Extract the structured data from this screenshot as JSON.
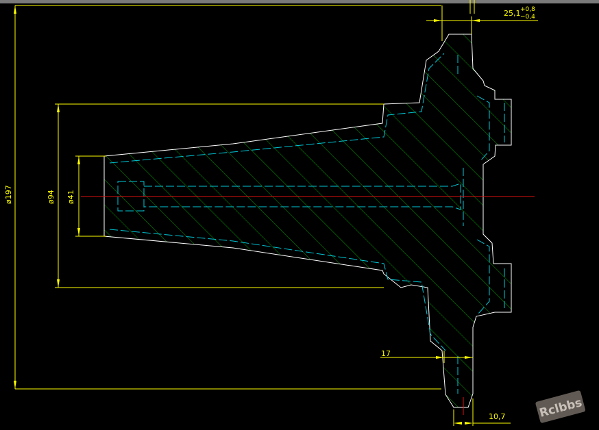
{
  "drawing": {
    "dimensions": {
      "dia_197": "ø197",
      "dia_94": "ø94",
      "dia_41": "ø41",
      "len_25_1": "25,1",
      "tol_plus": "+0,8",
      "tol_minus": "−0,4",
      "len_17": "17",
      "len_10_7": "10,7"
    },
    "colors": {
      "background": "#000000",
      "outline": "#ffffff",
      "hatch": "#00c800",
      "hidden": "#00c8d8",
      "dimension": "#ffff00",
      "centerline": "#e01010"
    }
  },
  "watermark": {
    "text": "Rclbbs"
  }
}
